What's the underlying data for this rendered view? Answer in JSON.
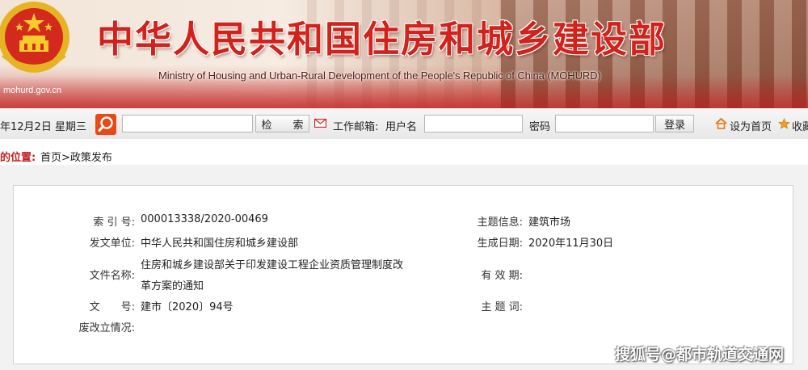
{
  "header": {
    "title_cn": "中华人民共和国住房和城乡建设部",
    "title_en": "Ministry of Housing and Urban-Rural Development of the People's Republic of China (MOHURD)",
    "site_url": "mohurd.gov.cn"
  },
  "toolbar": {
    "date": "年12月2日 星期三",
    "search_placeholder": "",
    "search_button": "检　　索",
    "mail_label": "工作邮箱:",
    "username_label": "用户名",
    "password_label": "密码",
    "login_button": "登录",
    "set_home": "设为首页",
    "favorite": "收藏"
  },
  "breadcrumb": {
    "label": "的位置:",
    "path": "首页>政策发布"
  },
  "info": {
    "index_label": "索 引 号:",
    "index_value": "000013338/2020-00469",
    "topic_label": "主题信息:",
    "topic_value": "建筑市场",
    "issuer_label": "发文单位:",
    "issuer_value": "中华人民共和国住房和城乡建设部",
    "date_label": "生成日期:",
    "date_value": "2020年11月30日",
    "name_label": "文件名称:",
    "name_value_line1": "住房和城乡建设部关于印发建设工程企业资质管理制度改",
    "name_value_line2": "革方案的通知",
    "validity_label": "有 效 期:",
    "validity_value": "",
    "docno_label": "文　　号:",
    "docno_value": "建市〔2020〕94号",
    "keyword_label": "主 题 词:",
    "keyword_value": "",
    "status_label": "废改立情况:",
    "status_value": ""
  },
  "watermark": "搜狐号@都市轨道交通网",
  "colors": {
    "title_red": "#d1221c",
    "search_orange": "#e84a17",
    "crumb_red": "#c3211c"
  }
}
